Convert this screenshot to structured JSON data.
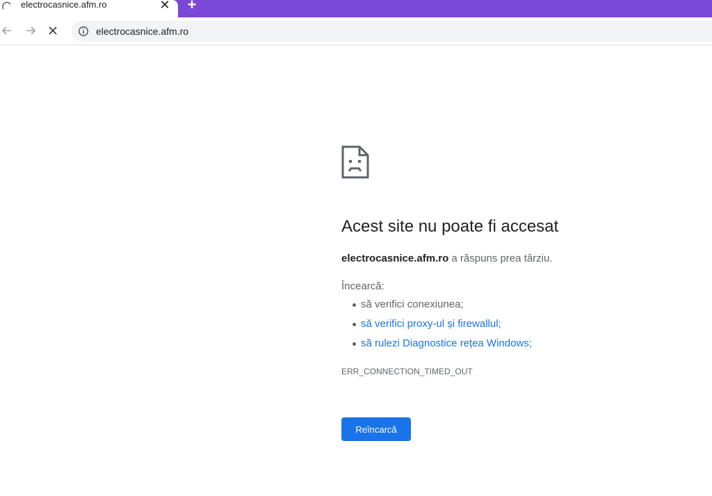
{
  "tab": {
    "title": "electrocasnice.afm.ro",
    "close_glyph": "✕",
    "new_tab_glyph": "+",
    "loading_icon": "loading-spinner-icon"
  },
  "toolbar": {
    "back_icon": "back-arrow-icon",
    "forward_icon": "forward-arrow-icon",
    "stop_icon": "stop-loading-icon",
    "info_icon": "info-icon",
    "url": "electrocasnice.afm.ro"
  },
  "error": {
    "icon": "sad-page-icon",
    "title": "Acest site nu poate fi accesat",
    "host": "electrocasnice.afm.ro",
    "message_rest": " a răspuns prea târziu.",
    "try_heading": "Încearcă:",
    "suggestions": [
      {
        "text": "să verifici conexiunea;"
      },
      {
        "text": "să verifici proxy-ul și firewallul;"
      },
      {
        "text": "să rulezi Diagnostice rețea Windows;"
      }
    ],
    "code": "ERR_CONNECTION_TIMED_OUT",
    "reload_label": "Reîncarcă"
  },
  "colors": {
    "tabstrip": "#7b47d6",
    "link": "#1a73e8",
    "button": "#1a73e8",
    "text_primary": "#202124",
    "text_secondary": "#5f6368"
  }
}
